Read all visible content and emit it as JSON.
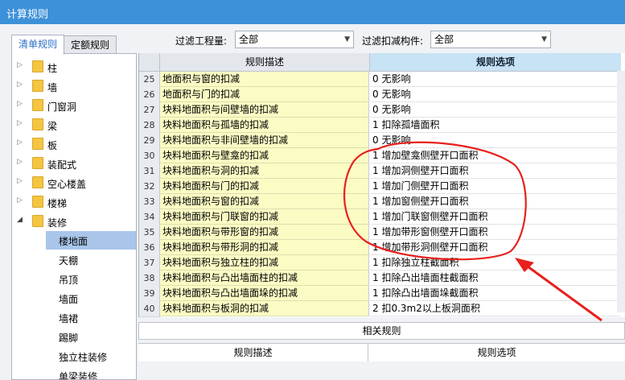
{
  "window": {
    "title": "计算规则"
  },
  "tabs": [
    {
      "label": "清单规则",
      "active": true
    },
    {
      "label": "定额规则",
      "active": false
    }
  ],
  "filters": {
    "quantity_label": "过滤工程量:",
    "quantity_value": "全部",
    "component_label": "过滤扣减构件:",
    "component_value": "全部"
  },
  "tree": {
    "items": [
      {
        "label": "柱",
        "expanded": false
      },
      {
        "label": "墙",
        "expanded": false
      },
      {
        "label": "门窗洞",
        "expanded": false
      },
      {
        "label": "梁",
        "expanded": false
      },
      {
        "label": "板",
        "expanded": false
      },
      {
        "label": "装配式",
        "expanded": false
      },
      {
        "label": "空心楼盖",
        "expanded": false
      },
      {
        "label": "楼梯",
        "expanded": false
      },
      {
        "label": "装修",
        "expanded": true
      }
    ],
    "children": [
      {
        "label": "楼地面",
        "selected": true
      },
      {
        "label": "天棚"
      },
      {
        "label": "吊顶"
      },
      {
        "label": "墙面"
      },
      {
        "label": "墙裙"
      },
      {
        "label": "踢脚"
      },
      {
        "label": "独立柱装修"
      },
      {
        "label": "单梁装修"
      }
    ]
  },
  "grid": {
    "header_desc": "规则描述",
    "header_options": "规则选项",
    "rows": [
      {
        "num": "25",
        "desc": "地面积与窗的扣减",
        "opt": "0  无影响"
      },
      {
        "num": "26",
        "desc": "地面积与门的扣减",
        "opt": "0  无影响"
      },
      {
        "num": "27",
        "desc": "块料地面积与间壁墙的扣减",
        "opt": "0  无影响"
      },
      {
        "num": "28",
        "desc": "块料地面积与孤墙的扣减",
        "opt": "1  扣除孤墙面积"
      },
      {
        "num": "29",
        "desc": "块料地面积与非间壁墙的扣减",
        "opt": "0  无影响"
      },
      {
        "num": "30",
        "desc": "块料地面积与壁龛的扣减",
        "opt": "1  增加壁龛侧壁开口面积"
      },
      {
        "num": "31",
        "desc": "块料地面积与洞的扣减",
        "opt": "1  增加洞侧壁开口面积"
      },
      {
        "num": "32",
        "desc": "块料地面积与门的扣减",
        "opt": "1  增加门侧壁开口面积"
      },
      {
        "num": "33",
        "desc": "块料地面积与窗的扣减",
        "opt": "1  增加窗侧壁开口面积"
      },
      {
        "num": "34",
        "desc": "块料地面积与门联窗的扣减",
        "opt": "1  增加门联窗侧壁开口面积"
      },
      {
        "num": "35",
        "desc": "块料地面积与带形窗的扣减",
        "opt": "1  增加带形窗侧壁开口面积"
      },
      {
        "num": "36",
        "desc": "块料地面积与带形洞的扣减",
        "opt": "1  增加带形洞侧壁开口面积"
      },
      {
        "num": "37",
        "desc": "块料地面积与独立柱的扣减",
        "opt": "1  扣除独立柱截面积"
      },
      {
        "num": "38",
        "desc": "块料地面积与凸出墙面柱的扣减",
        "opt": "1  扣除凸出墙面柱截面积"
      },
      {
        "num": "39",
        "desc": "块料地面积与凸出墙面垛的扣减",
        "opt": "1  扣除凸出墙面垛截面积"
      },
      {
        "num": "40",
        "desc": "块料地面积与板洞的扣减",
        "opt": "2  扣0.3m2以上板洞面积"
      }
    ]
  },
  "related": {
    "title": "相关规则",
    "header_desc": "规则描述",
    "header_options": "规则选项"
  },
  "colors": {
    "titlebar": "#3c91d8",
    "desc_cell": "#fbfbc4",
    "option_header": "#c7e3f5",
    "annotation": "#e8201c"
  }
}
